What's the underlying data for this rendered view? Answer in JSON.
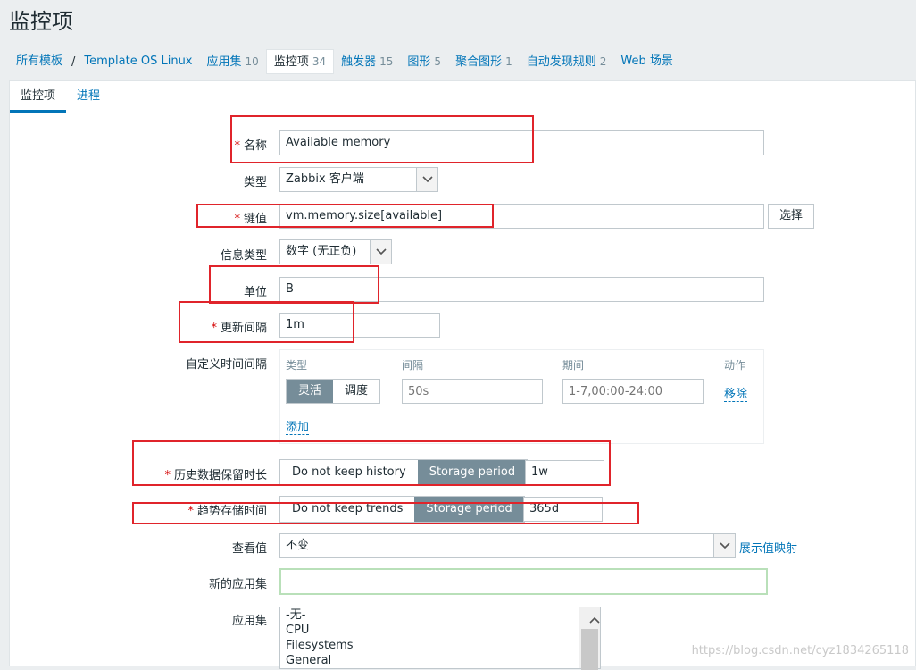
{
  "page_title": "监控项",
  "nav": [
    {
      "label": "所有模板"
    },
    {
      "label": "Template OS Linux"
    },
    {
      "label": "应用集",
      "count": "10"
    },
    {
      "label": "监控项",
      "count": "34"
    },
    {
      "label": "触发器",
      "count": "15"
    },
    {
      "label": "图形",
      "count": "5"
    },
    {
      "label": "聚合图形",
      "count": "1"
    },
    {
      "label": "自动发现规则",
      "count": "2"
    },
    {
      "label": "Web 场景"
    }
  ],
  "tabs": [
    "监控项",
    "进程"
  ],
  "form": {
    "name_label": "名称",
    "name_value": "Available memory",
    "type_label": "类型",
    "type_value": "Zabbix 客户端",
    "key_label": "键值",
    "key_value": "vm.memory.size[available]",
    "key_button": "选择",
    "info_type_label": "信息类型",
    "info_type_value": "数字 (无正负)",
    "units_label": "单位",
    "units_value": "B",
    "interval_label": "更新间隔",
    "interval_value": "1m",
    "custom_label": "自定义时间间隔",
    "custom": {
      "col_type": "类型",
      "col_interval": "间隔",
      "col_period": "期间",
      "col_action": "动作",
      "type_flexible": "灵活",
      "type_scheduling": "调度",
      "interval_placeholder": "50s",
      "period_placeholder": "1-7,00:00-24:00",
      "remove": "移除",
      "add": "添加"
    },
    "history_label": "历史数据保留时长",
    "history_opt_no": "Do not keep history",
    "history_opt_storage": "Storage period",
    "history_value": "1w",
    "trends_label": "趋势存储时间",
    "trends_opt_no": "Do not keep trends",
    "trends_opt_storage": "Storage period",
    "trends_value": "365d",
    "valuemap_label": "查看值",
    "valuemap_value": "不变",
    "valuemap_link": "展示值映射",
    "new_app_label": "新的应用集",
    "new_app_value": "",
    "apps_label": "应用集",
    "apps": [
      "-无-",
      "CPU",
      "Filesystems",
      "General"
    ]
  },
  "watermark": "https://blog.csdn.net/cyz1834265118"
}
